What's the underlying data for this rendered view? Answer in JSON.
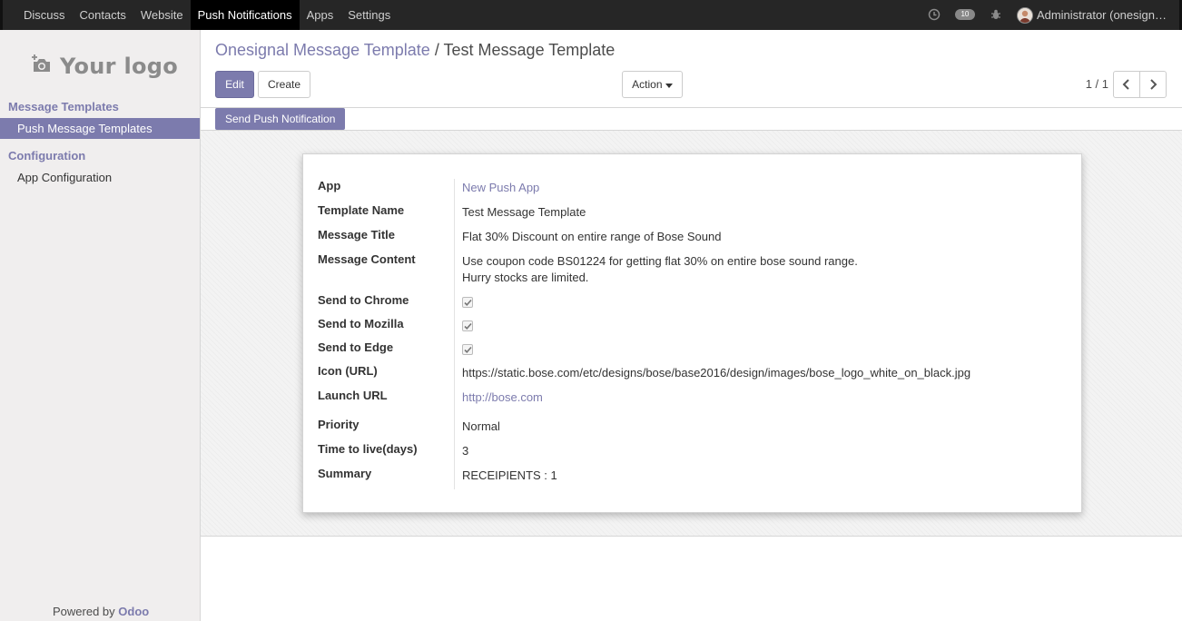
{
  "topnav": {
    "items": [
      "Discuss",
      "Contacts",
      "Website",
      "Push Notifications",
      "Apps",
      "Settings"
    ],
    "active_index": 3,
    "messages_count": "10",
    "user": "Administrator (onesign…"
  },
  "sidebar": {
    "logo_text": "Your logo",
    "sections": [
      {
        "title": "Message Templates",
        "items": [
          "Push Message Templates"
        ]
      },
      {
        "title": "Configuration",
        "items": [
          "App Configuration"
        ]
      }
    ],
    "powered_by": "Powered by",
    "powered_brand": "Odoo"
  },
  "control_panel": {
    "breadcrumb_parent": "Onesignal Message Template",
    "breadcrumb_sep": "/",
    "breadcrumb_current": "Test Message Template",
    "edit_label": "Edit",
    "create_label": "Create",
    "action_label": "Action",
    "pager": "1 / 1"
  },
  "header": {
    "send_button": "Send Push Notification"
  },
  "form": {
    "fields": [
      {
        "label": "App",
        "value": "New Push App",
        "type": "link"
      },
      {
        "label": "Template Name",
        "value": "Test Message Template",
        "type": "text"
      },
      {
        "label": "Message Title",
        "value": "Flat 30% Discount on entire range of Bose Sound",
        "type": "text"
      },
      {
        "label": "Message Content",
        "value": "Use coupon code BS01224 for getting flat 30% on entire bose sound range.",
        "value2": "Hurry stocks are limited.",
        "type": "text"
      },
      {
        "label": "Send to Chrome",
        "checked": true,
        "type": "checkbox"
      },
      {
        "label": "Send to Mozilla",
        "checked": true,
        "type": "checkbox"
      },
      {
        "label": "Send to Edge",
        "checked": true,
        "type": "checkbox"
      },
      {
        "label": "Icon (URL)",
        "value": "https://static.bose.com/etc/designs/bose/base2016/design/images/bose_logo_white_on_black.jpg",
        "type": "text"
      },
      {
        "label": "Launch URL",
        "value": "http://bose.com",
        "type": "link"
      },
      {
        "label": "Priority",
        "value": "Normal",
        "type": "text"
      },
      {
        "label": "Time to live(days)",
        "value": "3",
        "type": "text"
      },
      {
        "label": "Summary",
        "value": "RECEIPIENTS : 1",
        "type": "text"
      }
    ]
  },
  "colors": {
    "brand": "#7c7bad",
    "topbar": "#262626"
  }
}
